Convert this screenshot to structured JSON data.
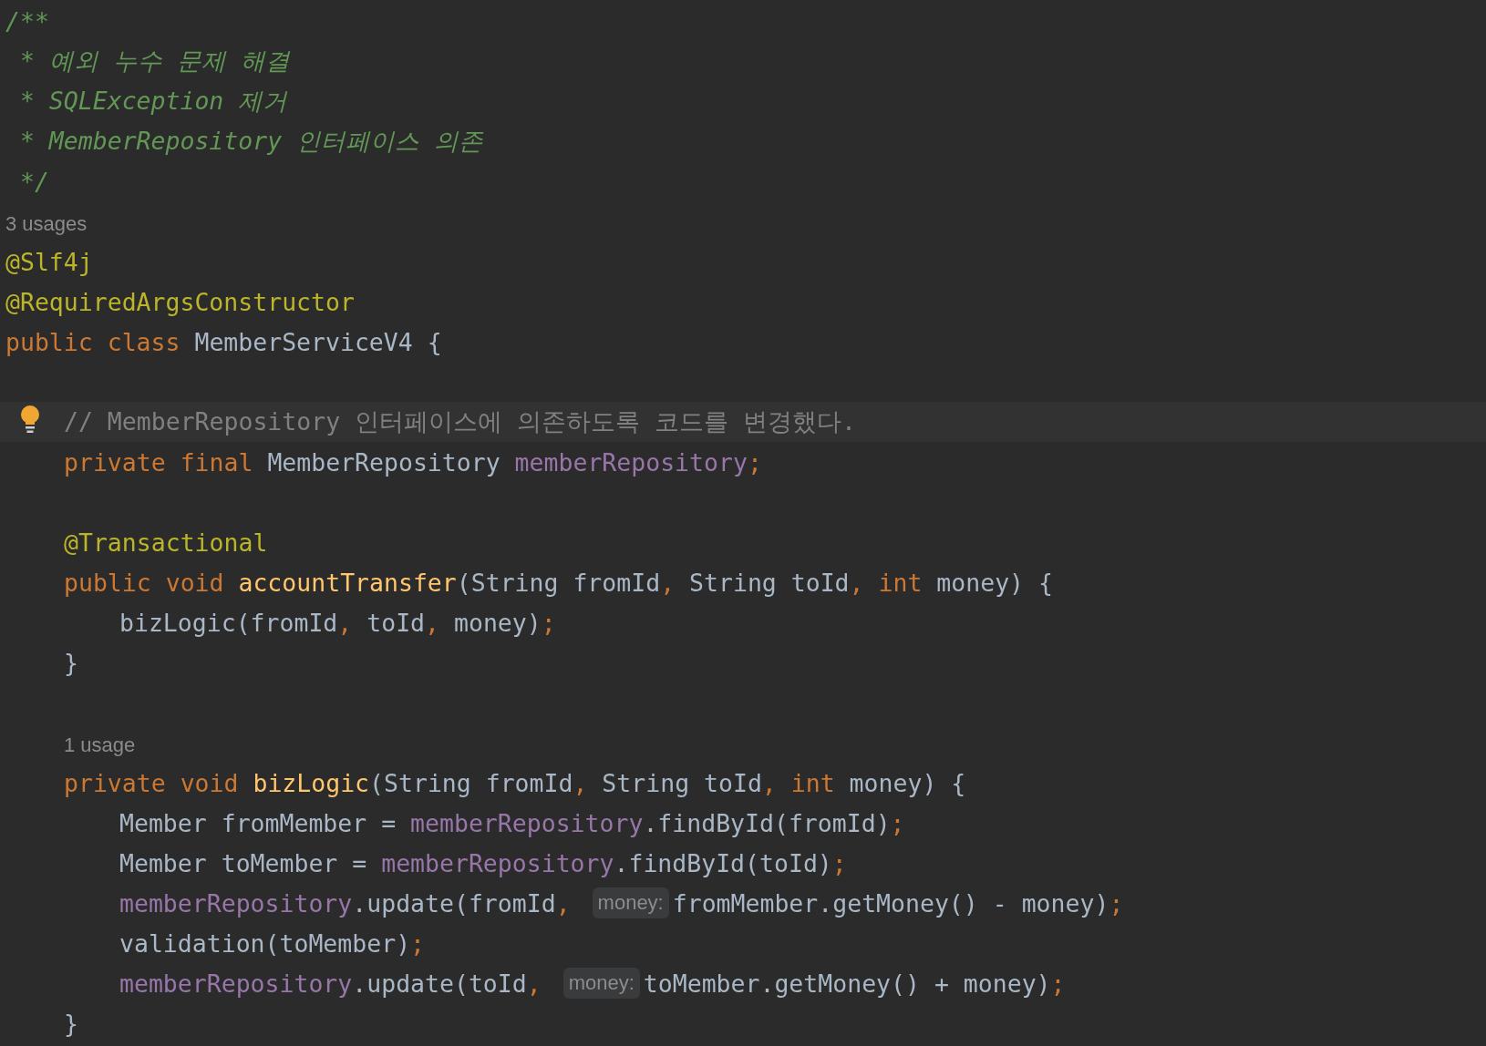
{
  "editor": {
    "lines": [
      {
        "kind": "top",
        "tokens": [
          {
            "kind": "doc",
            "text": "/**"
          }
        ]
      },
      {
        "kind": "top",
        "tokens": [
          {
            "kind": "doc",
            "text": " * 예외 누수 문제 해결"
          }
        ]
      },
      {
        "kind": "top",
        "tokens": [
          {
            "kind": "doc",
            "text": " * SQLException 제거"
          }
        ]
      },
      {
        "kind": "top",
        "tokens": [
          {
            "kind": "doc",
            "text": " * MemberRepository 인터페이스 의존"
          }
        ]
      },
      {
        "kind": "top",
        "tokens": [
          {
            "kind": "doc",
            "text": " */"
          }
        ]
      },
      {
        "kind": "top",
        "tokens": [
          {
            "kind": "usage",
            "text": "3 usages"
          }
        ]
      },
      {
        "kind": "top",
        "tokens": [
          {
            "kind": "annotation",
            "text": "@Slf4j"
          }
        ]
      },
      {
        "kind": "top",
        "tokens": [
          {
            "kind": "annotation",
            "text": "@RequiredArgsConstructor"
          }
        ]
      },
      {
        "kind": "top",
        "tokens": [
          {
            "kind": "keyword",
            "text": "public class "
          },
          {
            "kind": "plain",
            "text": "MemberServiceV4 {"
          }
        ]
      },
      {
        "kind": "blank"
      },
      {
        "kind": "member",
        "current": true,
        "bulb": true,
        "tokens": [
          {
            "kind": "comment",
            "text": "// MemberRepository 인터페이스에 의존하도록 코드를 변경했다."
          }
        ]
      },
      {
        "kind": "member",
        "tokens": [
          {
            "kind": "keyword",
            "text": "private final "
          },
          {
            "kind": "plain",
            "text": "MemberRepository "
          },
          {
            "kind": "field",
            "text": "memberRepository"
          },
          {
            "kind": "punct",
            "text": ";"
          }
        ]
      },
      {
        "kind": "blank"
      },
      {
        "kind": "member",
        "tokens": [
          {
            "kind": "annotation",
            "text": "@Transactional"
          }
        ]
      },
      {
        "kind": "member",
        "tokens": [
          {
            "kind": "keyword",
            "text": "public void "
          },
          {
            "kind": "method",
            "text": "accountTransfer"
          },
          {
            "kind": "plain",
            "text": "(String fromId"
          },
          {
            "kind": "punct",
            "text": ", "
          },
          {
            "kind": "plain",
            "text": "String toId"
          },
          {
            "kind": "punct",
            "text": ", "
          },
          {
            "kind": "keyword",
            "text": "int "
          },
          {
            "kind": "plain",
            "text": "money) {"
          }
        ]
      },
      {
        "kind": "body",
        "tokens": [
          {
            "kind": "plain",
            "text": "bizLogic(fromId"
          },
          {
            "kind": "punct",
            "text": ", "
          },
          {
            "kind": "plain",
            "text": "toId"
          },
          {
            "kind": "punct",
            "text": ", "
          },
          {
            "kind": "plain",
            "text": "money)"
          },
          {
            "kind": "punct",
            "text": ";"
          }
        ]
      },
      {
        "kind": "member",
        "tokens": [
          {
            "kind": "plain",
            "text": "}"
          }
        ]
      },
      {
        "kind": "blank"
      },
      {
        "kind": "member",
        "tokens": [
          {
            "kind": "usage",
            "text": "1 usage"
          }
        ]
      },
      {
        "kind": "member",
        "tokens": [
          {
            "kind": "keyword",
            "text": "private void "
          },
          {
            "kind": "method",
            "text": "bizLogic"
          },
          {
            "kind": "plain",
            "text": "(String fromId"
          },
          {
            "kind": "punct",
            "text": ", "
          },
          {
            "kind": "plain",
            "text": "String toId"
          },
          {
            "kind": "punct",
            "text": ", "
          },
          {
            "kind": "keyword",
            "text": "int "
          },
          {
            "kind": "plain",
            "text": "money) {"
          }
        ]
      },
      {
        "kind": "body",
        "tokens": [
          {
            "kind": "plain",
            "text": "Member fromMember = "
          },
          {
            "kind": "field",
            "text": "memberRepository"
          },
          {
            "kind": "plain",
            "text": ".findById(fromId)"
          },
          {
            "kind": "punct",
            "text": ";"
          }
        ]
      },
      {
        "kind": "body",
        "tokens": [
          {
            "kind": "plain",
            "text": "Member toMember = "
          },
          {
            "kind": "field",
            "text": "memberRepository"
          },
          {
            "kind": "plain",
            "text": ".findById(toId)"
          },
          {
            "kind": "punct",
            "text": ";"
          }
        ]
      },
      {
        "kind": "body",
        "tokens": [
          {
            "kind": "field",
            "text": "memberRepository"
          },
          {
            "kind": "plain",
            "text": ".update(fromId"
          },
          {
            "kind": "punct",
            "text": ", "
          },
          {
            "kind": "hint",
            "text": "money:"
          },
          {
            "kind": "plain",
            "text": "fromMember.getMoney() - money)"
          },
          {
            "kind": "punct",
            "text": ";"
          }
        ]
      },
      {
        "kind": "body",
        "tokens": [
          {
            "kind": "plain",
            "text": "validation(toMember)"
          },
          {
            "kind": "punct",
            "text": ";"
          }
        ]
      },
      {
        "kind": "body",
        "tokens": [
          {
            "kind": "field",
            "text": "memberRepository"
          },
          {
            "kind": "plain",
            "text": ".update(toId"
          },
          {
            "kind": "punct",
            "text": ", "
          },
          {
            "kind": "hint",
            "text": "money:"
          },
          {
            "kind": "plain",
            "text": "toMember.getMoney() + money)"
          },
          {
            "kind": "punct",
            "text": ";"
          }
        ]
      },
      {
        "kind": "member",
        "tokens": [
          {
            "kind": "plain",
            "text": "}"
          }
        ]
      }
    ]
  }
}
